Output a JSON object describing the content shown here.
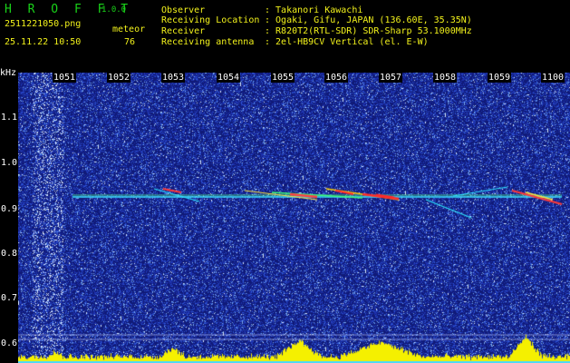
{
  "header": {
    "app_name": "H R O F F T",
    "version": "1.0.0",
    "filename": "2511221050.png",
    "datetime": "25.11.22 10:50",
    "meteor_label": "meteor",
    "meteor_count": "76",
    "info_labels": [
      "Observer",
      "Receiving Location",
      "Receiver",
      "Receiving antenna"
    ],
    "info_values": [
      ": Takanori Kawachi",
      ": Ogaki, Gifu, JAPAN (136.60E, 35.35N)",
      ": R820T2(RTL-SDR) SDR-Sharp 53.1000MHz",
      ": 2el-HB9CV Vertical (el. E-W)"
    ]
  },
  "axes": {
    "y_unit": "kHz",
    "x_ticks": [
      "1051",
      "1052",
      "1053",
      "1054",
      "1055",
      "1056",
      "1057",
      "1058",
      "1059",
      "1100"
    ],
    "y_ticks": [
      "1.1",
      "1.0",
      "0.9",
      "0.8",
      "0.7",
      "0.6"
    ]
  },
  "colors": {
    "noise": "#1e2fb0",
    "trace": "#3ee6ff",
    "meteor_hot": "#ff2020",
    "text_yellow": "#f2f21b",
    "text_green": "#19d219",
    "bars": "#f5f000"
  }
}
